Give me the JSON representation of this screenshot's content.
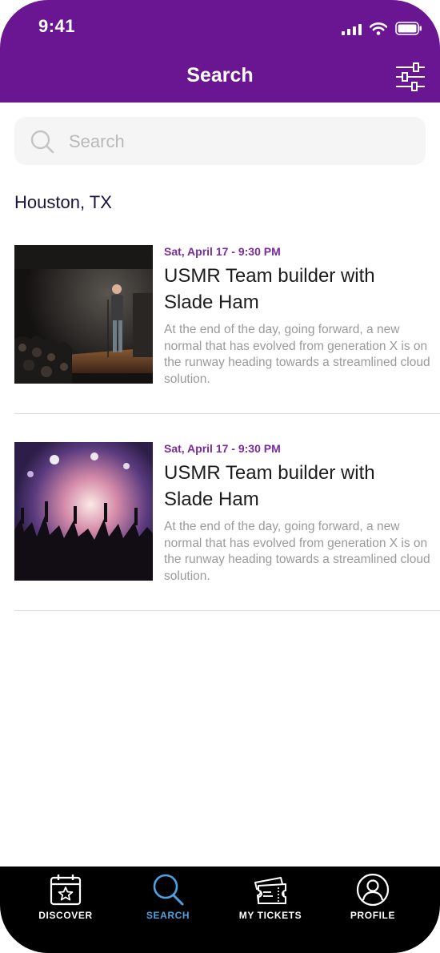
{
  "status_bar": {
    "time": "9:41"
  },
  "header": {
    "title": "Search",
    "filter_icon": "sliders-icon"
  },
  "search": {
    "placeholder": "Search",
    "value": ""
  },
  "location": "Houston, TX",
  "events": [
    {
      "date": "Sat, April 17 - 9:30 PM",
      "title": "USMR Team builder with Slade Ham",
      "description": "At the end of the day, going forward, a new normal that has evolved from generation X is on the runway heading towards a streamlined cloud solution.",
      "image": "comedian-on-stage-photo"
    },
    {
      "date": "Sat, April 17 - 9:30 PM",
      "title": "USMR Team builder with Slade Ham",
      "description": "At the end of the day, going forward, a new normal that has evolved from generation X is on the runway heading towards a streamlined cloud solution.",
      "image": "concert-crowd-photo"
    }
  ],
  "tabs": [
    {
      "label": "DISCOVER",
      "icon": "calendar-star-icon",
      "active": false
    },
    {
      "label": "SEARCH",
      "icon": "search-icon",
      "active": true
    },
    {
      "label": "MY TICKETS",
      "icon": "tickets-icon",
      "active": false
    },
    {
      "label": "PROFILE",
      "icon": "user-circle-icon",
      "active": false
    }
  ],
  "colors": {
    "header": "#6a1591",
    "date_accent": "#7a2aa0",
    "active_tab": "#4aa3e4",
    "tabbar": "#000000"
  }
}
